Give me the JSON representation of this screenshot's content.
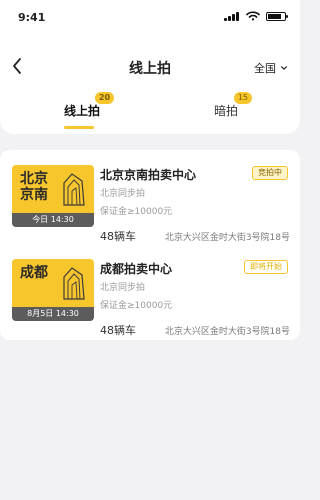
{
  "status_bar": {
    "time": "9:41"
  },
  "nav": {
    "title": "线上拍",
    "region": "全国"
  },
  "tabs": [
    {
      "label": "线上拍",
      "badge": "20",
      "active": true
    },
    {
      "label": "暗拍",
      "badge": "15",
      "active": false
    }
  ],
  "auctions": [
    {
      "thumb_title_line1": "北京",
      "thumb_title_line2": "京南",
      "thumb_time": "今日 14:30",
      "name": "北京京南拍卖中心",
      "status": "竞拍中",
      "sync": "北京同步拍",
      "deposit": "保证金≥10000元",
      "count": "48辆车",
      "address": "北京大兴区金时大街3号院18号"
    },
    {
      "thumb_title_line1": "成都",
      "thumb_title_line2": "",
      "thumb_time": "8月5日 14:30",
      "name": "成都拍卖中心",
      "status": "即将开始",
      "sync": "北京同步拍",
      "deposit": "保证金≥10000元",
      "count": "48辆车",
      "address": "北京大兴区金时大街3号院18号"
    }
  ],
  "colors": {
    "accent": "#f7c52c",
    "badge_text": "#7a5b00",
    "strip": "#5c5c5c"
  },
  "icons": {
    "back": "chevron-left-icon",
    "region": "chevron-down-icon",
    "auction_building": "building-icon"
  }
}
